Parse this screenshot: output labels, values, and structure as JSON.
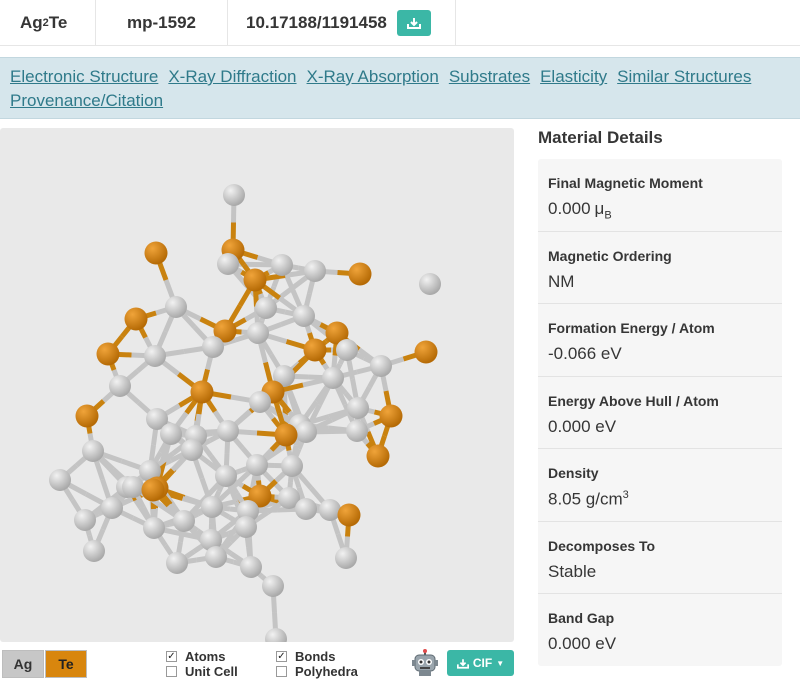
{
  "header": {
    "formula_base": "Ag",
    "formula_sub": "2",
    "formula_end": "Te",
    "material_id": "mp-1592",
    "doi": "10.17188/1191458",
    "download_icon": "download-icon"
  },
  "nav": {
    "links": [
      "Electronic Structure",
      "X-Ray Diffraction",
      "X-Ray Absorption",
      "Substrates",
      "Elasticity",
      "Similar Structures",
      "Provenance/Citation"
    ]
  },
  "viewer": {
    "element_buttons": [
      {
        "label": "Ag",
        "color": "#c7c7c7"
      },
      {
        "label": "Te",
        "color": "#d8860e"
      }
    ],
    "toggles": {
      "atoms": "Atoms",
      "bonds": "Bonds",
      "unit_cell": "Unit Cell",
      "polyhedra": "Polyhedra"
    },
    "cif_label": "CIF",
    "robot_icon": "robot-icon",
    "colors": {
      "ag": "#c9c9c9",
      "te": "#d4810c",
      "background": "#e9e9e9"
    }
  },
  "details": {
    "title": "Material Details",
    "final_magnetic_moment": {
      "label": "Final Magnetic Moment",
      "value": "0.000",
      "unit": "μ",
      "unit_sub": "B"
    },
    "magnetic_ordering": {
      "label": "Magnetic Ordering",
      "value": "NM"
    },
    "formation_energy": {
      "label": "Formation Energy / Atom",
      "value": "-0.066 eV"
    },
    "energy_above_hull": {
      "label": "Energy Above Hull / Atom",
      "value": "0.000 eV"
    },
    "density": {
      "label": "Density",
      "value": "8.05 g/cm",
      "value_sup": "3"
    },
    "decomposes_to": {
      "label": "Decomposes To",
      "value": "Stable"
    },
    "band_gap": {
      "label": "Band Gap",
      "value": "0.000 eV"
    }
  },
  "colors": {
    "accent": "#3bb7a6",
    "nav_bg": "#d6e6ec",
    "nav_link": "#2f7a8a"
  }
}
